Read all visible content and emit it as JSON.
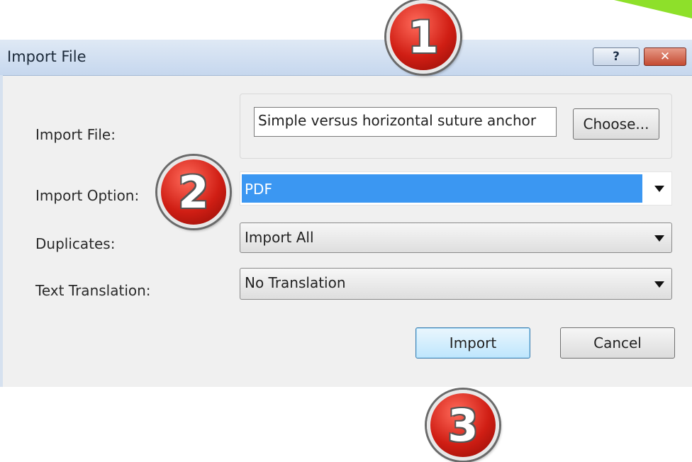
{
  "window": {
    "title": "Import File",
    "help_label": "?",
    "close_label": "✕"
  },
  "form": {
    "import_file_label": "Import File:",
    "import_file_value": "Simple versus horizontal suture anchor",
    "choose_label": "Choose...",
    "import_option_label": "Import Option:",
    "import_option_value": "PDF",
    "duplicates_label": "Duplicates:",
    "duplicates_value": "Import All",
    "text_translation_label": "Text Translation:",
    "text_translation_value": "No Translation"
  },
  "buttons": {
    "import_label": "Import",
    "cancel_label": "Cancel"
  },
  "callouts": [
    "1",
    "2",
    "3"
  ],
  "colors": {
    "selection": "#3b97f2",
    "callout_red": "#d01e14",
    "accent_green": "#8ee02a"
  }
}
